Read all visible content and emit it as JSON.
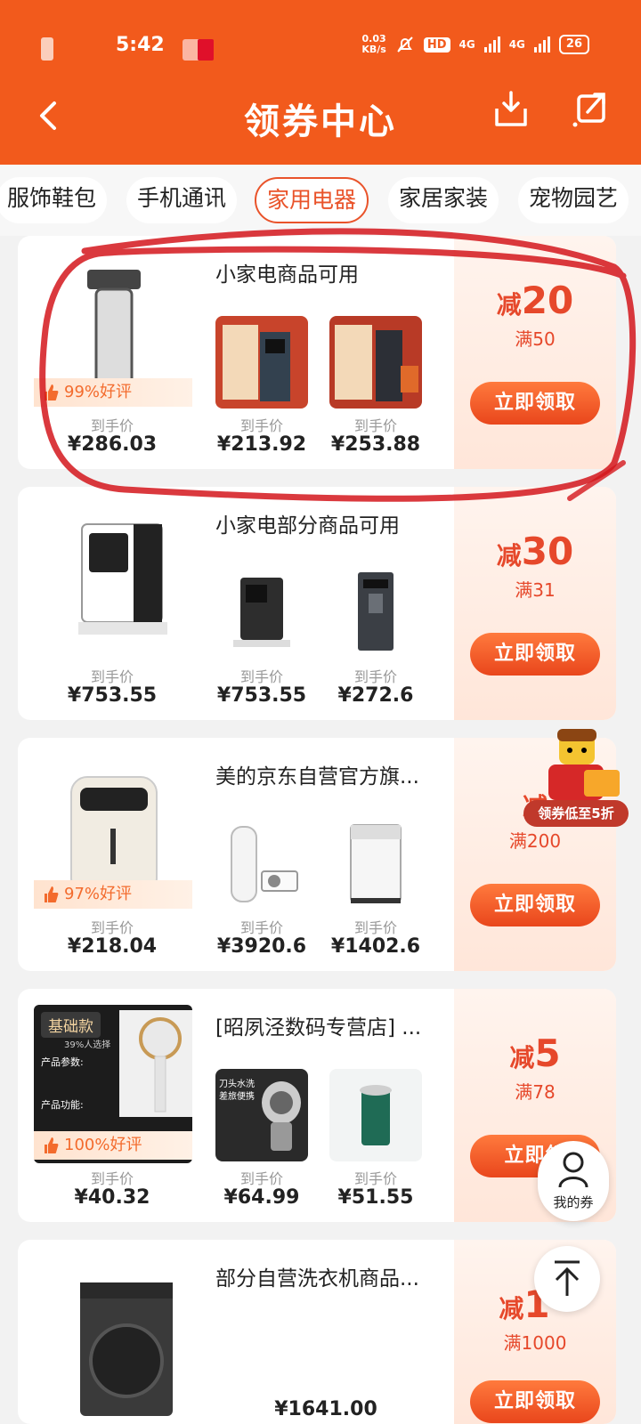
{
  "status": {
    "time": "5:42",
    "speed_top": "0.03",
    "speed_bottom": "KB/s",
    "hd": "HD",
    "net1": "4G",
    "net2": "4G",
    "battery": "26"
  },
  "nav": {
    "title": "领券中心"
  },
  "tabs": [
    {
      "label": "服饰鞋包",
      "active": false
    },
    {
      "label": "手机通讯",
      "active": false
    },
    {
      "label": "家用电器",
      "active": true
    },
    {
      "label": "家居家装",
      "active": false
    },
    {
      "label": "宠物园艺",
      "active": false
    }
  ],
  "colors": {
    "brand": "#f25a1c",
    "accent": "#e6482b"
  },
  "coupons": [
    {
      "shop": "小家电商品可用",
      "jian": "减",
      "amount": "20",
      "condition": "满50",
      "button": "立即领取",
      "praise": "99%好评",
      "price_label": "到手价",
      "prices": [
        "¥286.03",
        "¥213.92",
        "¥253.88"
      ]
    },
    {
      "shop": "小家电部分商品可用",
      "jian": "减",
      "amount": "30",
      "condition": "满31",
      "button": "立即领取",
      "praise": "",
      "price_label": "到手价",
      "prices": [
        "¥753.55",
        "¥753.55",
        "¥272.6"
      ]
    },
    {
      "shop": "美的京东自营官方旗...",
      "jian": "减",
      "amount": "",
      "condition": "满200",
      "button": "立即领取",
      "praise": "97%好评",
      "price_label": "到手价",
      "prices": [
        "¥218.04",
        "¥3920.6",
        "¥1402.6"
      ]
    },
    {
      "shop": "[昭夙泾数码专营店] ...",
      "jian": "减",
      "amount": "5",
      "condition": "满78",
      "button": "立即领",
      "praise": "100%好评",
      "price_label": "到手价",
      "prices": [
        "¥40.32",
        "¥64.99",
        "¥51.55"
      ],
      "image_text": {
        "tag": "基础款",
        "sub": "39%人选择",
        "params": "产品参数:",
        "funcs": "产品功能:"
      },
      "thumb_text": {
        "line1": "刀头水洗",
        "line2": "差旅便携"
      }
    },
    {
      "shop": "部分自营洗衣机商品...",
      "jian": "减",
      "amount": "1",
      "condition": "满1000",
      "button": "立即领取",
      "praise": "",
      "price_label": "",
      "prices": [
        "",
        "¥1641.00",
        ""
      ]
    }
  ],
  "promo": {
    "label": "领券低至5折"
  },
  "float": {
    "my_coupons": "我的券"
  }
}
